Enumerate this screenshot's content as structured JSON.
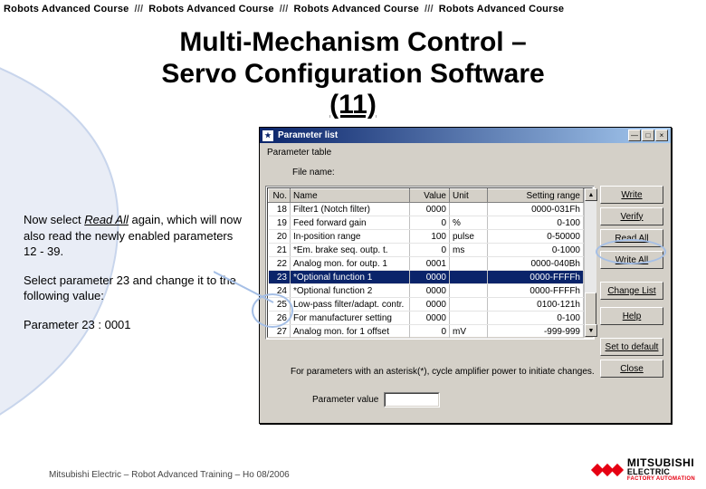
{
  "header_repeat": "Robots Advanced Course",
  "header_sep": "///",
  "title_l1": "Multi-Mechanism Control –",
  "title_l2": "Servo Configuration Software",
  "title_l3": "(11)",
  "instructions": {
    "p1a": "Now select ",
    "p1em": "Read All",
    "p1b": " again, which will now also read the newly enabled parameters 12 - 39.",
    "p2": "Select parameter 23 and change it to the following value:",
    "p3": "Parameter 23 : 0001"
  },
  "window": {
    "title": "Parameter list",
    "param_label": "Parameter table",
    "file_label": "File name:",
    "buttons": [
      "Write",
      "Verify",
      "Read All",
      "Write All",
      "Change List",
      "Help",
      "Set to default",
      "Close"
    ],
    "note": "For parameters with an asterisk(*), cycle amplifier power to initiate changes.",
    "pv_label": "Parameter value",
    "pv_value": "",
    "columns": [
      "No.",
      "Name",
      "Value",
      "Unit",
      "Setting range"
    ],
    "rows": [
      {
        "no": "18",
        "name": "Filter1 (Notch filter)",
        "val": "0000",
        "unit": "",
        "rng": "0000-031Fh"
      },
      {
        "no": "19",
        "name": "Feed forward gain",
        "val": "0",
        "unit": "%",
        "rng": "0-100"
      },
      {
        "no": "20",
        "name": "In-position range",
        "val": "100",
        "unit": "pulse",
        "rng": "0-50000"
      },
      {
        "no": "21",
        "name": "*Em. brake seq. outp. t.",
        "val": "0",
        "unit": "ms",
        "rng": "0-1000"
      },
      {
        "no": "22",
        "name": "Analog mon. for outp. 1",
        "val": "0001",
        "unit": "",
        "rng": "0000-040Bh"
      },
      {
        "no": "23",
        "name": "*Optional function 1",
        "val": "0000",
        "unit": "",
        "rng": "0000-FFFFh",
        "sel": true
      },
      {
        "no": "24",
        "name": "*Optional function 2",
        "val": "0000",
        "unit": "",
        "rng": "0000-FFFFh"
      },
      {
        "no": "25",
        "name": "Low-pass filter/adapt. contr.",
        "val": "0000",
        "unit": "",
        "rng": "0100-121h"
      },
      {
        "no": "26",
        "name": "For manufacturer setting",
        "val": "0000",
        "unit": "",
        "rng": "0-100"
      },
      {
        "no": "27",
        "name": "Analog mon. for 1 offset",
        "val": "0",
        "unit": "mV",
        "rng": "-999-999"
      }
    ]
  },
  "footer": "Mitsubishi Electric – Robot Advanced Training – Ho 08/2006",
  "brand": {
    "name": "MITSUBISHI",
    "sub": "ELECTRIC",
    "tag": "FACTORY AUTOMATION"
  }
}
